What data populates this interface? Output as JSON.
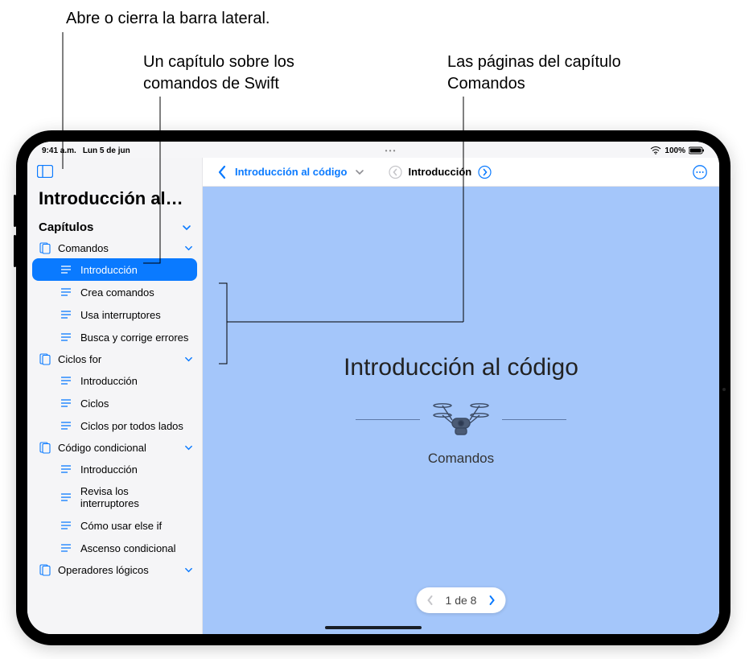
{
  "callouts": {
    "sidebar_toggle": "Abre o cierra la barra lateral.",
    "chapter_swift": "Un capítulo sobre los comandos de Swift",
    "pages_comandos": "Las páginas del capítulo Comandos"
  },
  "statusbar": {
    "time": "9:41 a.m.",
    "date": "Lun 5 de jun",
    "battery": "100%"
  },
  "sidebar": {
    "title": "Introducción al…",
    "section_label": "Capítulos",
    "chapters": [
      {
        "label": "Comandos",
        "expanded": true,
        "pages": [
          {
            "label": "Introducción",
            "selected": true
          },
          {
            "label": "Crea comandos",
            "selected": false
          },
          {
            "label": "Usa interruptores",
            "selected": false
          },
          {
            "label": "Busca y corrige errores",
            "selected": false
          }
        ]
      },
      {
        "label": "Ciclos for",
        "expanded": true,
        "pages": [
          {
            "label": "Introducción",
            "selected": false
          },
          {
            "label": "Ciclos",
            "selected": false
          },
          {
            "label": "Ciclos por todos lados",
            "selected": false
          }
        ]
      },
      {
        "label": "Código condicional",
        "expanded": true,
        "pages": [
          {
            "label": "Introducción",
            "selected": false
          },
          {
            "label": "Revisa los interruptores",
            "selected": false
          },
          {
            "label": "Cómo usar else if",
            "selected": false
          },
          {
            "label": "Ascenso condicional",
            "selected": false
          }
        ]
      },
      {
        "label": "Operadores lógicos",
        "expanded": true,
        "pages": []
      }
    ]
  },
  "toolbar": {
    "back_label": "",
    "project": "Introducción al código",
    "page": "Introducción"
  },
  "canvas": {
    "title": "Introducción al código",
    "subtitle": "Comandos"
  },
  "pager": {
    "label": "1 de 8",
    "prev_enabled": false,
    "next_enabled": true
  }
}
